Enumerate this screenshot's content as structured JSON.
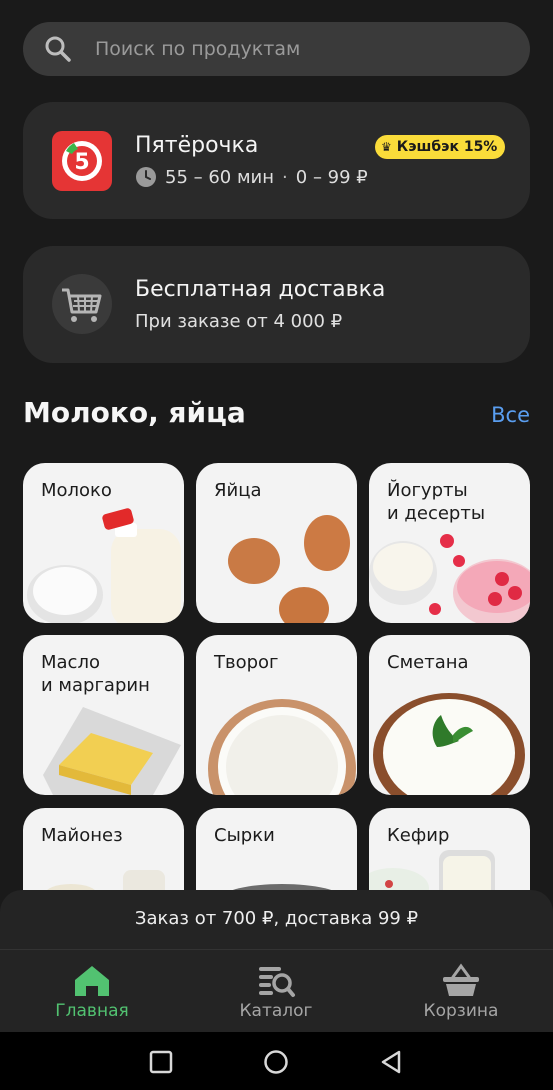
{
  "search": {
    "placeholder": "Поиск по продуктам"
  },
  "store": {
    "name": "Пятёрочка",
    "logo_text": "5",
    "eta": "55 – 60 мин",
    "delivery_price": "0 – 99 ₽",
    "cashback": "Кэшбэк 15%"
  },
  "promo": {
    "title": "Бесплатная доставка",
    "subtitle": "При заказе от 4 000 ₽"
  },
  "section": {
    "title": "Молоко, яйца",
    "all_label": "Все"
  },
  "categories": [
    {
      "label": "Молоко"
    },
    {
      "label": "Яйца"
    },
    {
      "label": "Йогурты\nи десерты"
    },
    {
      "label": "Масло\nи маргарин"
    },
    {
      "label": "Творог"
    },
    {
      "label": "Сметана"
    },
    {
      "label": "Майонез"
    },
    {
      "label": "Сырки"
    },
    {
      "label": "Кефир"
    }
  ],
  "order_bar": {
    "text": "Заказ от 700 ₽, доставка 99 ₽"
  },
  "tabs": [
    {
      "label": "Главная",
      "icon": "home-icon",
      "active": true
    },
    {
      "label": "Каталог",
      "icon": "catalog-search-icon",
      "active": false
    },
    {
      "label": "Корзина",
      "icon": "basket-icon",
      "active": false
    }
  ],
  "colors": {
    "accent_green": "#52c271",
    "link_blue": "#5a9ef0",
    "cashback_yellow": "#fadc3a",
    "brand_red": "#e53535"
  }
}
